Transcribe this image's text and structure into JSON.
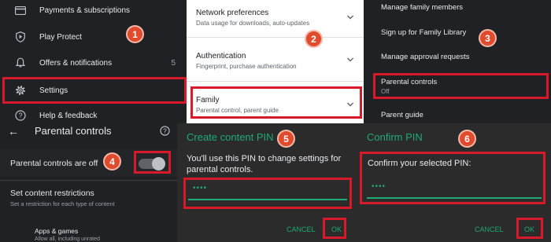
{
  "play_menu": {
    "items": [
      {
        "label": "Payments & subscriptions",
        "icon": "card-icon"
      },
      {
        "label": "Play Protect",
        "icon": "shield-icon"
      },
      {
        "label": "Offers & notifications",
        "icon": "bell-icon",
        "count": "5"
      },
      {
        "label": "Settings",
        "icon": "gear-icon"
      },
      {
        "label": "Help & feedback",
        "icon": "help-icon"
      }
    ]
  },
  "settings_list": {
    "rows": [
      {
        "title": "Network preferences",
        "subtitle": "Data usage for downloads, auto-updates"
      },
      {
        "title": "Authentication",
        "subtitle": "Fingerprint, purchase authentication"
      },
      {
        "title": "Family",
        "subtitle": "Parental control, parent guide"
      }
    ]
  },
  "family_menu": {
    "items": [
      {
        "label": "Manage family members"
      },
      {
        "label": "Sign up for Family Library"
      },
      {
        "label": "Manage approval requests"
      },
      {
        "label": "Parental controls",
        "subtitle": "Off"
      },
      {
        "label": "Parent guide"
      }
    ]
  },
  "parental_controls": {
    "title": "Parental controls",
    "toggle_label": "Parental controls are off",
    "toggle_on": false,
    "restrictions_title": "Set content restrictions",
    "restrictions_sub": "Set a restriction for each type of content",
    "apps_title": "Apps & games",
    "apps_sub": "Allow all, including unrated"
  },
  "create_pin_dialog": {
    "title": "Create content PIN",
    "body": "You'll use this PIN to change settings for parental controls.",
    "pin_value": "••••",
    "cancel_label": "CANCEL",
    "ok_label": "OK"
  },
  "confirm_pin_dialog": {
    "title": "Confirm PIN",
    "body": "Confirm your selected PIN:",
    "pin_value": "••••",
    "cancel_label": "CANCEL",
    "ok_label": "OK"
  },
  "step_badges": [
    "1",
    "2",
    "3",
    "4",
    "5",
    "6"
  ],
  "colors": {
    "accent_green": "#1faa73",
    "highlight_red": "#d7192a",
    "badge_orange": "#e04b2d",
    "dark_bg": "#202124",
    "dialog_bg": "#2b2b2b"
  }
}
